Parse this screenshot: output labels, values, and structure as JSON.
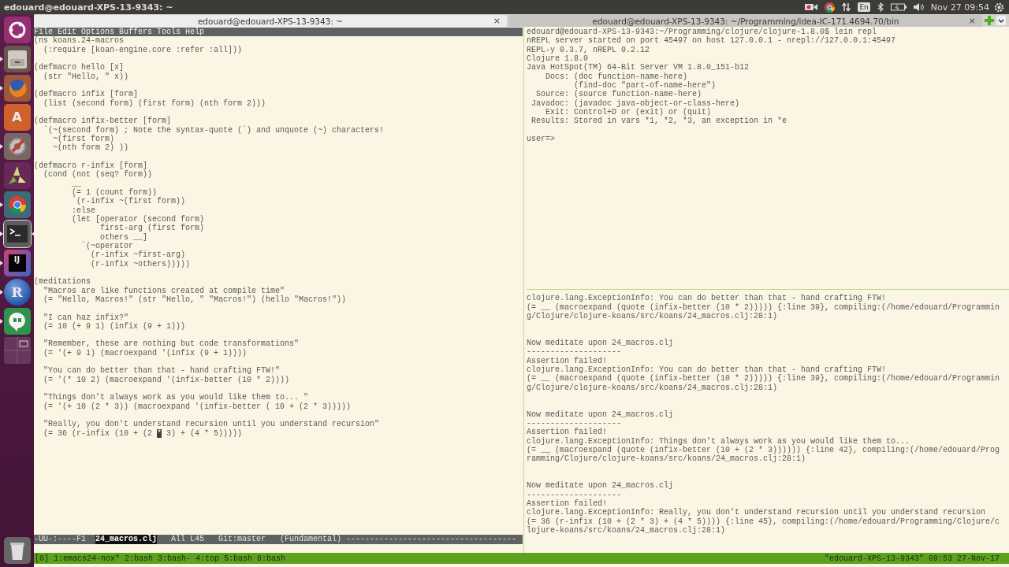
{
  "top_bar": {
    "title": "edouard@edouard-XPS-13-9343: ~",
    "indicators": [
      {
        "kind": "camera"
      },
      {
        "kind": "chrome"
      },
      {
        "kind": "transfer"
      },
      {
        "kind": "keyboard",
        "text": "En"
      },
      {
        "kind": "bluetooth"
      },
      {
        "kind": "battery"
      },
      {
        "kind": "volume"
      }
    ],
    "clock": "Nov 27 09:54"
  },
  "launcher": [
    {
      "kind": "ubuntu",
      "running": false,
      "selected": false
    },
    {
      "kind": "files",
      "running": true,
      "selected": false
    },
    {
      "kind": "firefox",
      "running": true,
      "selected": false
    },
    {
      "kind": "software",
      "running": false,
      "selected": false,
      "glyph": "A"
    },
    {
      "kind": "settings",
      "running": true,
      "selected": false
    },
    {
      "kind": "triangles",
      "running": false,
      "selected": false
    },
    {
      "kind": "chrome",
      "running": true,
      "selected": false
    },
    {
      "kind": "terminal",
      "running": true,
      "selected": true
    },
    {
      "kind": "ide",
      "running": true,
      "selected": false,
      "glyph": "IJ"
    },
    {
      "kind": "r",
      "running": true,
      "selected": false,
      "glyph": "R"
    },
    {
      "kind": "hangouts",
      "running": true,
      "selected": false
    },
    {
      "kind": "workspaces",
      "running": false,
      "selected": false
    },
    {
      "kind": "trash",
      "running": false,
      "selected": false
    }
  ],
  "tabs": [
    {
      "title": "edouard@edouard-XPS-13-9343: ~",
      "close": "×",
      "selected": true
    },
    {
      "title": "edouard@edouard-XPS-13-9343: ~/Programming/idea-IC-171.4694.70/bin",
      "close": "×",
      "selected": false
    }
  ],
  "emacs": {
    "menu": [
      "File",
      "Edit",
      "Options",
      "Buffers",
      "Tools",
      "Help"
    ],
    "code": [
      [
        "(ns koans.24-macros",
        "  (:require [koan-engine.core :refer :all]))"
      ],
      [
        "(defmacro hello [x]",
        "  (str \"Hello, \" x))"
      ],
      [
        "(defmacro infix [form]",
        "  (list (second form) (first form) (nth form 2)))"
      ],
      [
        "(defmacro infix-better [form]",
        "  `(~(second form) ; Note the syntax-quote (`) and unquote (~) characters!",
        "    ~(first form)",
        "    ~(nth form 2) ))"
      ],
      [
        "(defmacro r-infix [form]",
        "  (cond (not (seq? form))",
        "        __",
        "        (= 1 (count form))",
        "        `(r-infix ~(first form))",
        "        :else",
        "        (let [operator (second form)",
        "              first-arg (first form)",
        "              others __]",
        "          `(~operator",
        "            (r-infix ~first-arg)",
        "            (r-infix ~others)))))"
      ],
      [
        "(meditations",
        "  \"Macros are like functions created at compile time\"",
        "  (= \"Hello, Macros!\" (str \"Hello, \" \"Macros!\") (hello \"Macros!\"))"
      ],
      [
        "  \"I can haz infix?\"",
        "  (= 10 (+ 9 1) (infix (9 + 1)))"
      ],
      [
        "  \"Remember, these are nothing but code transformations\"",
        "  (= '(+ 9 1) (macroexpand '(infix (9 + 1))))"
      ],
      [
        "  \"You can do better than that - hand crafting FTW!\"",
        "  (= '(* 10 2) (macroexpand '(infix-better (10 * 2))))"
      ],
      [
        "  \"Things don't always work as you would like them to... \"",
        "  (= '(+ 10 (2 * 3)) (macroexpand '(infix-better ( 10 + (2 * 3)))))"
      ],
      [
        "  \"Really, you don't understand recursion until you understand recursion\"",
        {
          "before": "  (= 36 (r-infix (10 + (2 ",
          "cursor": "*",
          "after": " 3) + (4 * 5)))))"
        }
      ]
    ],
    "mode_line": {
      "status": "-UU-:----F1",
      "buffer": "24_macros.clj",
      "position": "All L45",
      "branch": "Git:master",
      "mode": "(Fundamental)",
      "fill": "------------------------------------"
    }
  },
  "repl": [
    [
      "edouard@edouard-XPS-13-9343:~/Programming/clojure/clojure-1.8.0$ lein repl",
      "nREPL server started on port 45497 on host 127.0.0.1 - nrepl://127.0.0.1:45497",
      "REPL-y 0.3.7, nREPL 0.2.12",
      "Clojure 1.8.0",
      "Java HotSpot(TM) 64-Bit Server VM 1.8.0_151-b12",
      "    Docs: (doc function-name-here)",
      "          (find-doc \"part-of-name-here\")",
      "  Source: (source function-name-here)",
      " Javadoc: (javadoc java-object-or-class-here)",
      "    Exit: Control+D or (exit) or (quit)",
      " Results: Stored in vars *1, *2, *3, an exception in *e"
    ],
    [
      "user=>"
    ]
  ],
  "output": [
    [
      "clojure.lang.ExceptionInfo: You can do better than that - hand crafting FTW!",
      "(= __ (macroexpand (quote (infix-better (10 * 2))))) {:line 39}, compiling:(/home/edouard/Programmin",
      "g/Clojure/clojure-koans/src/koans/24_macros.clj:28:1)"
    ],
    [
      "Now meditate upon 24_macros.clj",
      "--------------------",
      "Assertion failed!",
      "clojure.lang.ExceptionInfo: You can do better than that - hand crafting FTW!",
      "(= __ (macroexpand (quote (infix-better (10 * 2))))) {:line 39}, compiling:(/home/edouard/Programmin",
      "g/Clojure/clojure-koans/src/koans/24_macros.clj:28:1)"
    ],
    [
      "Now meditate upon 24_macros.clj",
      "--------------------",
      "Assertion failed!",
      "clojure.lang.ExceptionInfo: Things don't always work as you would like them to...",
      "(= __ (macroexpand (quote (infix-better (10 + (2 * 3)))))) {:line 42}, compiling:(/home/edouard/Prog",
      "ramming/Clojure/clojure-koans/src/koans/24_macros.clj:28:1)"
    ],
    [
      "Now meditate upon 24_macros.clj",
      "--------------------",
      "Assertion failed!",
      "clojure.lang.ExceptionInfo: Really, you don't understand recursion until you understand recursion",
      "(= 36 (r-infix (10 + (2 * 3) + (4 * 5)))) {:line 45}, compiling:(/home/edouard/Programming/Clojure/c",
      "lojure-koans/src/koans/24_macros.clj:28:1)"
    ]
  ],
  "tmux": {
    "session": "[0]",
    "windows": [
      "1:emacs24-nox*",
      "2:bash",
      "3:bash-",
      "4:top",
      "5:bash",
      "6:bash"
    ],
    "right": "\"edouard-XPS-13-9343\" 09:53 27-Nov-17"
  }
}
